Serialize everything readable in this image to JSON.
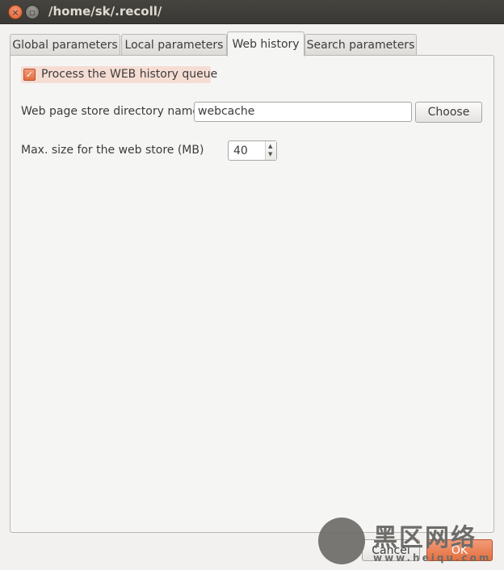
{
  "window": {
    "title": "/home/sk/.recoll/",
    "close_glyph": "×",
    "minimize_glyph": "▫"
  },
  "tabs": [
    {
      "label": "Global parameters",
      "active": false
    },
    {
      "label": "Local parameters",
      "active": false
    },
    {
      "label": "Web history",
      "active": true
    },
    {
      "label": "Search parameters",
      "active": false
    }
  ],
  "web_history": {
    "process_queue": {
      "label": "Process the WEB history queue",
      "checked": true,
      "check_glyph": "✓"
    },
    "store_dir": {
      "label": "Web page store directory name",
      "value": "webcache",
      "button": "Choose"
    },
    "max_size": {
      "label": "Max. size for the web store (MB)",
      "value": "40",
      "up": "▲",
      "down": "▼"
    }
  },
  "footer": {
    "cancel": "Cancel",
    "ok": "OK"
  },
  "watermark": {
    "text": "黑区网络",
    "url": "www.heiqu.com"
  },
  "colors": {
    "accent": "#e3703f",
    "titlebar": "#3c3b37",
    "background": "#f2f1f0"
  }
}
